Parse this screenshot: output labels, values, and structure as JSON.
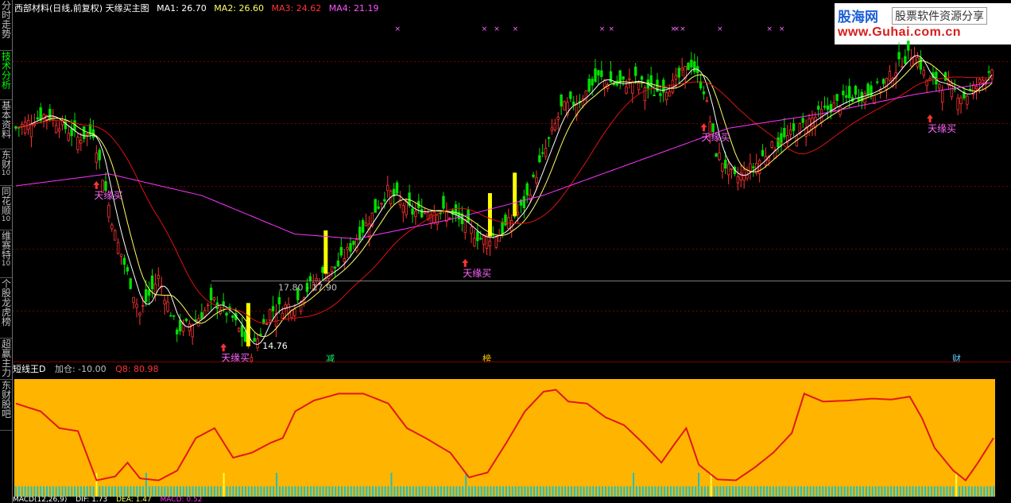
{
  "sidebar": {
    "tabs": [
      {
        "label": "分时走势",
        "sub": ""
      },
      {
        "label": "技术分析",
        "sub": "",
        "active": true
      },
      {
        "label": "基本资料",
        "sub": ""
      },
      {
        "label": "东财",
        "sub": "10"
      },
      {
        "label": "同花顺",
        "sub": "10"
      },
      {
        "label": "维赛特",
        "sub": "10"
      },
      {
        "label": "个股龙虎榜",
        "sub": ""
      },
      {
        "label": "超赢主力",
        "sub": ""
      },
      {
        "label": "东财股吧",
        "sub": ""
      }
    ]
  },
  "header": {
    "title": "西部材料(日线,前复权) 天缘买主图",
    "ma1": "MA1: 26.70",
    "ma2": "MA2: 26.60",
    "ma3": "MA3: 24.62",
    "ma4": "MA4: 21.19"
  },
  "watermark": {
    "brand": "股海网",
    "slogan": "股票软件资源分享",
    "url": "www.Guhai.com.cn"
  },
  "colors": {
    "up": "#ff3333",
    "down": "#00e000",
    "ma1": "#ffffff",
    "ma2": "#ffff66",
    "ma3": "#e01010",
    "ma4": "#ff33ff",
    "signal": "#ff3333",
    "panel": "#ffb400",
    "curve": "#e01818",
    "bar": "#20c0c0",
    "gridline": "#7a0000",
    "marker": "#ff66ff"
  },
  "annotations": {
    "buy_label": "天缘买",
    "price_range": "17.80 - 17.90",
    "low_label": "14.76",
    "badges": [
      "减",
      "榜",
      "财"
    ]
  },
  "chart_data": {
    "type": "candlestick",
    "series": [
      {
        "name": "MA1"
      },
      {
        "name": "MA2"
      },
      {
        "name": "MA3"
      },
      {
        "name": "MA4"
      }
    ],
    "price_points": [
      {
        "i": 0,
        "p": 24.2
      },
      {
        "i": 10,
        "p": 24.8
      },
      {
        "i": 20,
        "p": 23.8
      },
      {
        "i": 25,
        "p": 24.0
      },
      {
        "i": 32,
        "p": 19.8
      },
      {
        "i": 40,
        "p": 16.5
      },
      {
        "i": 46,
        "p": 18.0
      },
      {
        "i": 52,
        "p": 15.8
      },
      {
        "i": 58,
        "p": 16.2
      },
      {
        "i": 64,
        "p": 17.0
      },
      {
        "i": 70,
        "p": 16.3
      },
      {
        "i": 76,
        "p": 14.9
      },
      {
        "i": 82,
        "p": 16.6
      },
      {
        "i": 90,
        "p": 16.9
      },
      {
        "i": 96,
        "p": 17.8
      },
      {
        "i": 104,
        "p": 18.5
      },
      {
        "i": 112,
        "p": 20.0
      },
      {
        "i": 120,
        "p": 21.6
      },
      {
        "i": 128,
        "p": 20.7
      },
      {
        "i": 136,
        "p": 20.8
      },
      {
        "i": 142,
        "p": 20.5
      },
      {
        "i": 150,
        "p": 19.6
      },
      {
        "i": 156,
        "p": 19.8
      },
      {
        "i": 164,
        "p": 21.0
      },
      {
        "i": 170,
        "p": 23.0
      },
      {
        "i": 176,
        "p": 25.0
      },
      {
        "i": 182,
        "p": 25.4
      },
      {
        "i": 188,
        "p": 26.3
      },
      {
        "i": 194,
        "p": 26.0
      },
      {
        "i": 200,
        "p": 26.2
      },
      {
        "i": 206,
        "p": 25.7
      },
      {
        "i": 212,
        "p": 26.0
      },
      {
        "i": 218,
        "p": 26.9
      },
      {
        "i": 222,
        "p": 25.8
      },
      {
        "i": 226,
        "p": 23.2
      },
      {
        "i": 232,
        "p": 22.1
      },
      {
        "i": 238,
        "p": 22.6
      },
      {
        "i": 244,
        "p": 23.4
      },
      {
        "i": 250,
        "p": 23.9
      },
      {
        "i": 256,
        "p": 24.5
      },
      {
        "i": 262,
        "p": 25.0
      },
      {
        "i": 268,
        "p": 25.4
      },
      {
        "i": 274,
        "p": 25.6
      },
      {
        "i": 280,
        "p": 26.0
      },
      {
        "i": 286,
        "p": 27.0
      },
      {
        "i": 290,
        "p": 27.4
      },
      {
        "i": 294,
        "p": 26.2
      },
      {
        "i": 300,
        "p": 26.0
      },
      {
        "i": 306,
        "p": 25.5
      },
      {
        "i": 312,
        "p": 26.2
      },
      {
        "i": 315,
        "p": 26.8
      }
    ],
    "ma4_points": [
      {
        "i": 0,
        "p": 21.8
      },
      {
        "i": 30,
        "p": 22.3
      },
      {
        "i": 60,
        "p": 21.4
      },
      {
        "i": 90,
        "p": 19.8
      },
      {
        "i": 110,
        "p": 19.6
      },
      {
        "i": 140,
        "p": 20.4
      },
      {
        "i": 170,
        "p": 21.4
      },
      {
        "i": 200,
        "p": 22.8
      },
      {
        "i": 230,
        "p": 24.2
      },
      {
        "i": 260,
        "p": 24.8
      },
      {
        "i": 290,
        "p": 25.6
      },
      {
        "i": 315,
        "p": 26.1
      }
    ],
    "buy_signals": [
      26,
      67,
      145,
      222,
      295
    ],
    "yellow_bars": [
      75,
      100,
      153,
      161
    ],
    "price_ylim": [
      14.5,
      28.8
    ],
    "oscillator": {
      "title": "短线王D",
      "jiacang": "加仓: -10.00",
      "q8": "Q8: 80.98",
      "ylim": [
        0,
        100
      ],
      "points": [
        {
          "i": 0,
          "v": 80
        },
        {
          "i": 8,
          "v": 72
        },
        {
          "i": 14,
          "v": 55
        },
        {
          "i": 20,
          "v": 52
        },
        {
          "i": 26,
          "v": 2
        },
        {
          "i": 32,
          "v": 6
        },
        {
          "i": 36,
          "v": 20
        },
        {
          "i": 40,
          "v": 4
        },
        {
          "i": 46,
          "v": 2
        },
        {
          "i": 52,
          "v": 12
        },
        {
          "i": 58,
          "v": 45
        },
        {
          "i": 64,
          "v": 55
        },
        {
          "i": 70,
          "v": 25
        },
        {
          "i": 76,
          "v": 30
        },
        {
          "i": 82,
          "v": 40
        },
        {
          "i": 86,
          "v": 45
        },
        {
          "i": 90,
          "v": 72
        },
        {
          "i": 96,
          "v": 83
        },
        {
          "i": 104,
          "v": 90
        },
        {
          "i": 112,
          "v": 90
        },
        {
          "i": 120,
          "v": 80
        },
        {
          "i": 126,
          "v": 55
        },
        {
          "i": 132,
          "v": 45
        },
        {
          "i": 140,
          "v": 30
        },
        {
          "i": 146,
          "v": 5
        },
        {
          "i": 152,
          "v": 10
        },
        {
          "i": 158,
          "v": 40
        },
        {
          "i": 164,
          "v": 72
        },
        {
          "i": 170,
          "v": 92
        },
        {
          "i": 174,
          "v": 94
        },
        {
          "i": 178,
          "v": 82
        },
        {
          "i": 184,
          "v": 80
        },
        {
          "i": 190,
          "v": 66
        },
        {
          "i": 196,
          "v": 58
        },
        {
          "i": 202,
          "v": 40
        },
        {
          "i": 208,
          "v": 20
        },
        {
          "i": 212,
          "v": 38
        },
        {
          "i": 216,
          "v": 55
        },
        {
          "i": 220,
          "v": 18
        },
        {
          "i": 226,
          "v": 3
        },
        {
          "i": 232,
          "v": 2
        },
        {
          "i": 238,
          "v": 15
        },
        {
          "i": 244,
          "v": 30
        },
        {
          "i": 250,
          "v": 50
        },
        {
          "i": 254,
          "v": 90
        },
        {
          "i": 260,
          "v": 82
        },
        {
          "i": 268,
          "v": 83
        },
        {
          "i": 276,
          "v": 85
        },
        {
          "i": 282,
          "v": 84
        },
        {
          "i": 288,
          "v": 87
        },
        {
          "i": 292,
          "v": 65
        },
        {
          "i": 296,
          "v": 35
        },
        {
          "i": 302,
          "v": 12
        },
        {
          "i": 306,
          "v": 2
        },
        {
          "i": 310,
          "v": 20
        },
        {
          "i": 315,
          "v": 45
        }
      ],
      "tall_bars": [
        26,
        42,
        67,
        84,
        121,
        145,
        199,
        220,
        224,
        303
      ],
      "yellow_ticks": [
        26,
        67,
        224,
        303
      ]
    }
  },
  "bottom": {
    "macd": "MACD(12,26,9)",
    "dif": "DIF: 1.73",
    "dea": "DEA: 1.47",
    "macd_val": "MACD: 0.52"
  }
}
